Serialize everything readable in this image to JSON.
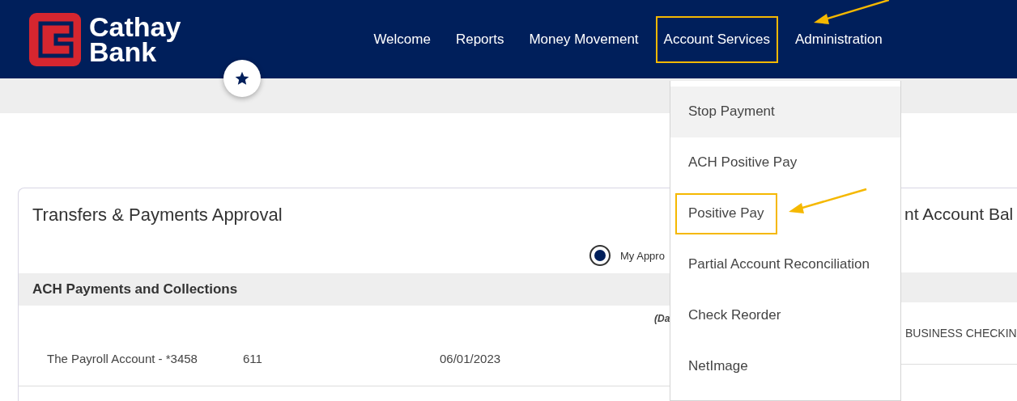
{
  "logo": {
    "line_1": "Cathay",
    "line_2": "Bank"
  },
  "nav": [
    {
      "label": "Welcome",
      "highlighted": false
    },
    {
      "label": "Reports",
      "highlighted": false
    },
    {
      "label": "Money Movement",
      "highlighted": false
    },
    {
      "label": "Account Services",
      "highlighted": true
    },
    {
      "label": "Administration",
      "highlighted": false
    }
  ],
  "menu": [
    {
      "label": "Stop Payment",
      "hovered": true,
      "highlighted": false
    },
    {
      "label": "ACH Positive Pay",
      "hovered": false,
      "highlighted": false
    },
    {
      "label": "Positive Pay",
      "hovered": false,
      "highlighted": true
    },
    {
      "label": "Partial Account Reconciliation",
      "hovered": false,
      "highlighted": false
    },
    {
      "label": "Check Reorder",
      "hovered": false,
      "highlighted": false
    },
    {
      "label": "NetImage",
      "hovered": false,
      "highlighted": false
    }
  ],
  "approval_card": {
    "title": "Transfers & Payments Approval",
    "radio": {
      "label": "My Appro",
      "selected": true
    },
    "section": "ACH Payments and Collections",
    "column_note": "(Da",
    "row": [
      "The Payroll Account - *3458",
      "611",
      "06/01/2023"
    ]
  },
  "balance_card": {
    "title": "nt Account Bal",
    "row": "BUSINESS CHECKIN"
  }
}
